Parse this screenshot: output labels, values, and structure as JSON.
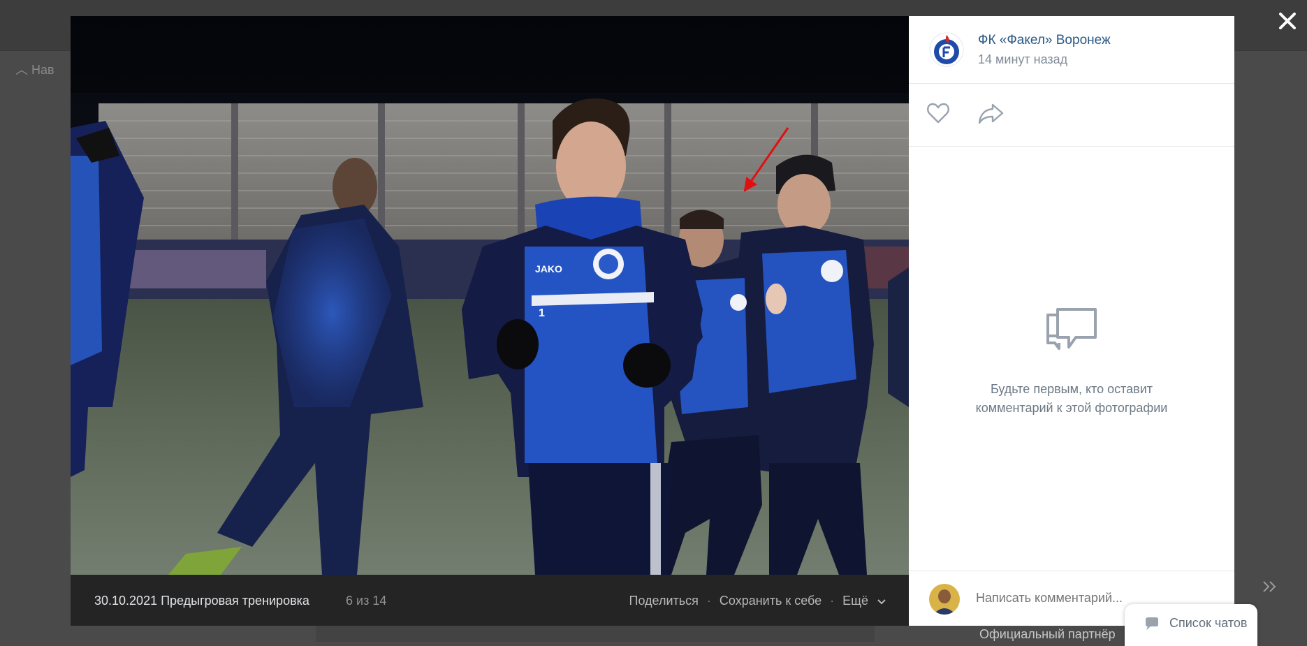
{
  "page": {
    "left_nav_label": "Нав",
    "right_footer_text": "Официальный партнёр"
  },
  "post": {
    "author": "ФК «Факел» Воронеж",
    "time": "14 минут назад"
  },
  "photo": {
    "title": "30.10.2021 Предыгровая тренировка",
    "counter": "6 из 14",
    "jersey_brand": "JAKO",
    "player_number": "1"
  },
  "actions": {
    "share": "Поделиться",
    "save": "Сохранить к себе",
    "more": "Ещё",
    "separator": "·"
  },
  "comments": {
    "empty_text_line1": "Будьте первым, кто оставит",
    "empty_text_line2": "комментарий к этой фотографии",
    "input_placeholder": "Написать комментарий..."
  },
  "chat": {
    "label": "Список чатов"
  },
  "icons": {
    "close": "close-icon",
    "like": "heart-icon",
    "share": "share-arrow-icon",
    "comments_empty": "speech-bubbles-icon",
    "chat": "chat-bubble-icon",
    "chevron": "chevron-down-icon",
    "next": "double-chevron-right-icon"
  },
  "colors": {
    "link": "#2a5885",
    "muted": "#818c99",
    "jersey_blue": "#1e4fc0",
    "jersey_navy": "#131a3a",
    "annotation_arrow": "#e01010"
  }
}
